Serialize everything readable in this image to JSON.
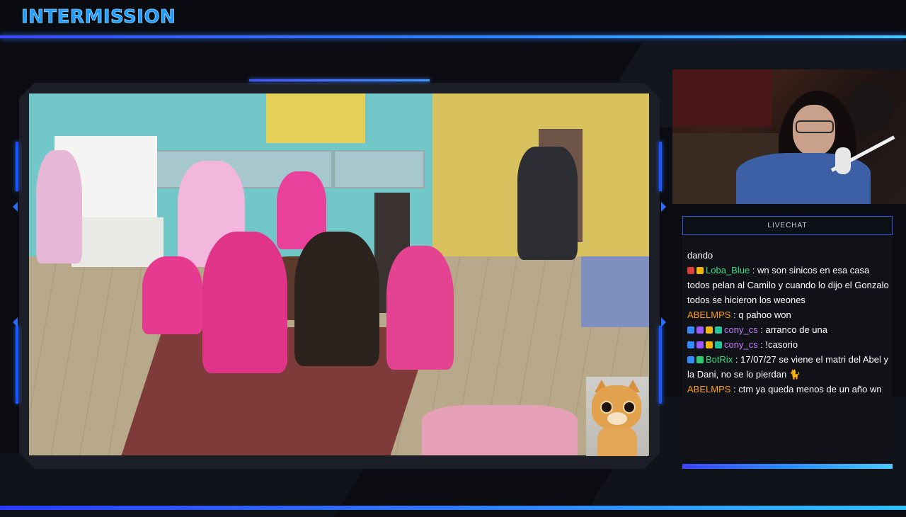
{
  "header": {
    "title": "INTERMISSION"
  },
  "chat": {
    "header_label": "LIVECHAT",
    "messages": [
      {
        "user": "",
        "text": "dando",
        "user_color": "#ffffff",
        "badges": []
      },
      {
        "user": "Loba_Blue",
        "text": ": wn son sinicos en esa casa todos pelan al Camilo y cuando lo dijo el Gonzalo todos se hicieron los weones",
        "user_color": "#3ddc84",
        "badges": [
          "#e23b3b",
          "#f2b705"
        ]
      },
      {
        "user": "ABELMPS",
        "text": ": q pahoo won",
        "user_color": "#ff9f1a",
        "badges": []
      },
      {
        "user": "cony_cs",
        "text": ": arranco de una",
        "user_color": "#c77dff",
        "badges": [
          "#2f8bff",
          "#9b59ff",
          "#f2b705",
          "#22c39a"
        ]
      },
      {
        "user": "cony_cs",
        "text": ": !casorio",
        "user_color": "#c77dff",
        "badges": [
          "#2f8bff",
          "#9b59ff",
          "#f2b705",
          "#22c39a"
        ]
      },
      {
        "user": "BotRix",
        "text": ": 17/07/27 se viene el matri del Abel y la Dani, no se lo pierdan 🐈",
        "user_color": "#3ddc84",
        "badges": [
          "#2f8bff",
          "#2ecc71"
        ]
      },
      {
        "user": "ABELMPS",
        "text": ": ctm ya queda menos de un año wn",
        "user_color": "#ff9f1a",
        "badges": []
      }
    ]
  },
  "colors": {
    "accent": "#2f86ff",
    "title": "#1e9bff",
    "background": "#0b0c12"
  }
}
